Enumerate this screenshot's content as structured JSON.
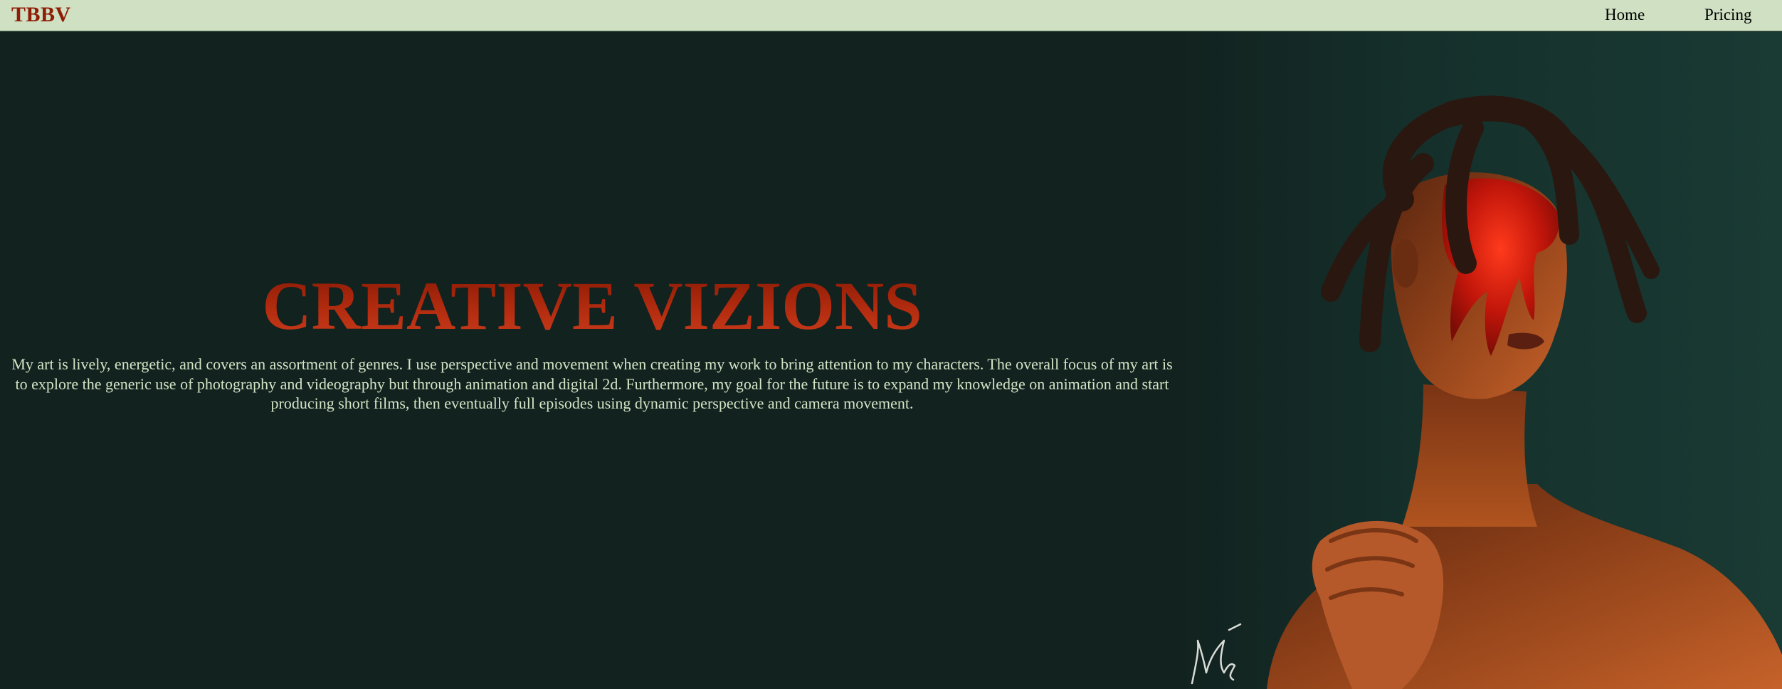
{
  "header": {
    "brand": "TBBV",
    "nav": [
      {
        "label": "Home"
      },
      {
        "label": "Pricing"
      }
    ]
  },
  "hero": {
    "title": "CREATIVE VIZIONS",
    "description": "My art is lively, energetic, and covers an assortment of genres. I use perspective and movement when creating my work to bring attention to my characters. The overall focus of my art is to explore the generic use of photography and videography but through animation and digital 2d. Furthermore, my goal for the future is to expand my knowledge on animation and start producing short films, then eventually full episodes using dynamic perspective and camera movement."
  },
  "colors": {
    "nav_bg": "#cfe0c3",
    "brand": "#8f1d06",
    "hero_bg": "#12221f",
    "title_gradient": [
      "#8a1a05",
      "#c83b1b"
    ],
    "body_text": "#d4e4c6"
  }
}
